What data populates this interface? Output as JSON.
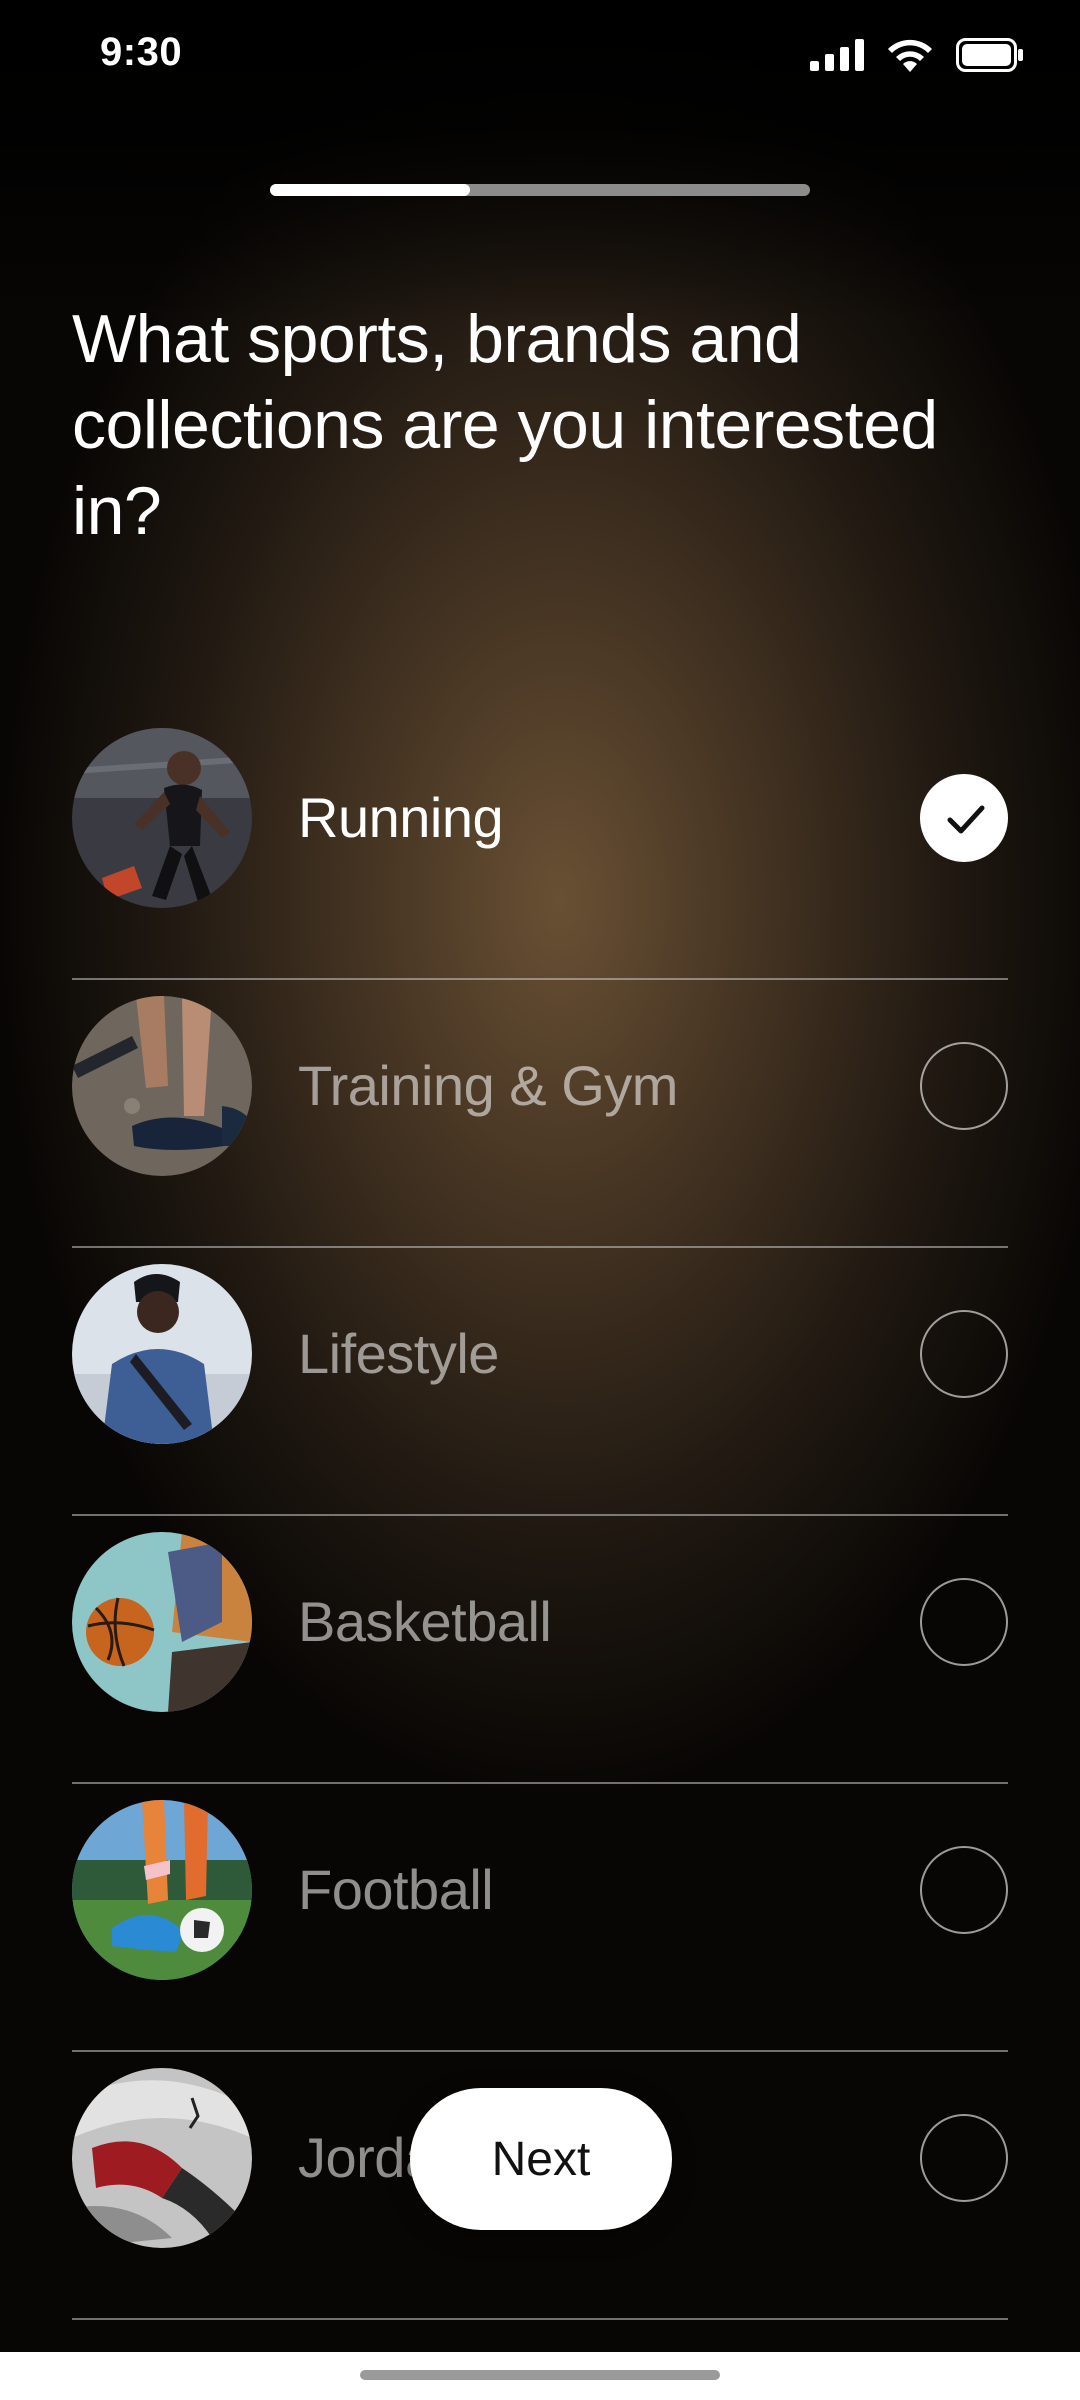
{
  "status_bar": {
    "time": "9:30",
    "icons": [
      "cellular-signal-icon",
      "wifi-icon",
      "battery-icon"
    ]
  },
  "onboarding": {
    "progress_fraction": 0.37
  },
  "question": "What sports, brands and collections are you interested in?",
  "options": [
    {
      "label": "Running",
      "selected": true,
      "thumbnail": "running-thumbnail"
    },
    {
      "label": "Training & Gym",
      "selected": false,
      "thumbnail": "training-gym-thumbnail"
    },
    {
      "label": "Lifestyle",
      "selected": false,
      "thumbnail": "lifestyle-thumbnail"
    },
    {
      "label": "Basketball",
      "selected": false,
      "thumbnail": "basketball-thumbnail"
    },
    {
      "label": "Football",
      "selected": false,
      "thumbnail": "football-thumbnail"
    },
    {
      "label": "Jordan",
      "selected": false,
      "thumbnail": "jordan-thumbnail"
    }
  ],
  "next_button": {
    "label": "Next"
  },
  "colors": {
    "accent": "#ffffff",
    "background_warm": "#6e5436",
    "unselected_text": "#8d8a86"
  }
}
